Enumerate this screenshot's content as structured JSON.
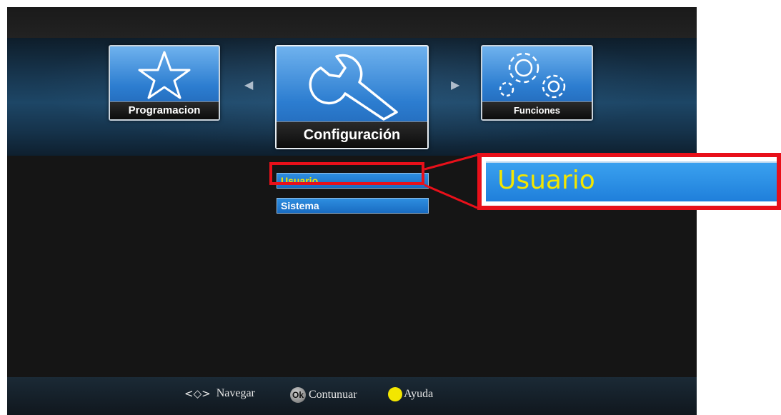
{
  "main_menu": {
    "items": [
      {
        "label": "Programacion",
        "icon": "star-icon"
      },
      {
        "label": "Configuración",
        "icon": "wrench-icon",
        "selected": true
      },
      {
        "label": "Funciones",
        "icon": "gears-icon"
      }
    ]
  },
  "submenu": {
    "items": [
      {
        "label": "Usuario",
        "selected": true
      },
      {
        "label": "Sistema"
      }
    ]
  },
  "zoom_callout": {
    "text": "Usuario"
  },
  "footer": {
    "nav_glyph": "<◇>",
    "nav_label": "Navegar",
    "ok_badge": "Ok",
    "ok_label": "Contunuar",
    "help_label": "Ayuda"
  },
  "colors": {
    "selected_text": "#f3e600",
    "highlight": "#e8101a",
    "item_blue": "#1f7fdb"
  }
}
